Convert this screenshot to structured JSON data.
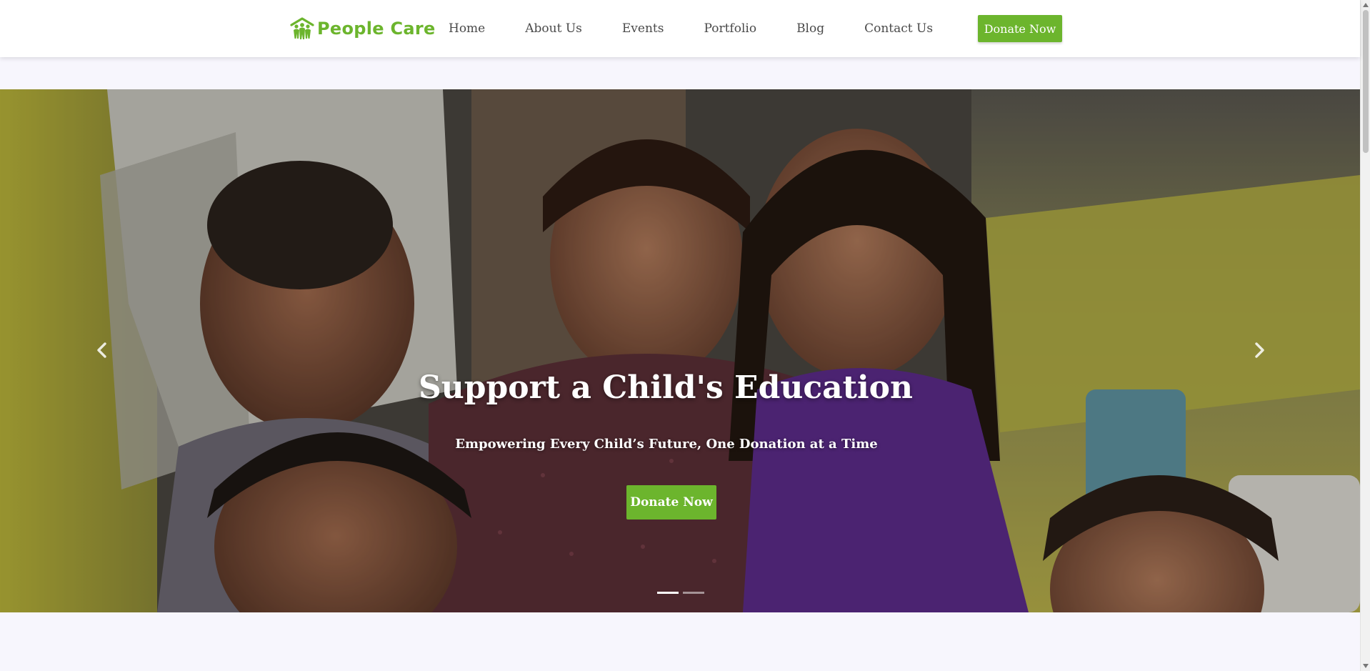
{
  "header": {
    "logo_text": "People Care",
    "nav": [
      {
        "label": "Home"
      },
      {
        "label": "About Us"
      },
      {
        "label": "Events"
      },
      {
        "label": "Portfolio"
      },
      {
        "label": "Blog"
      },
      {
        "label": "Contact Us"
      }
    ],
    "donate_label": "Donate Now"
  },
  "hero": {
    "title": "Support a Child's Education",
    "subtitle": "Empowering Every Child’s Future, One Donation at a Time",
    "donate_label": "Donate Now",
    "prev_icon": "chevron-left-icon",
    "next_icon": "chevron-right-icon",
    "slides_total": 2,
    "active_slide": 1
  },
  "colors": {
    "brand_green": "#6cb52d",
    "page_background": "#f7f6fd",
    "nav_text": "#4a4a4a"
  }
}
